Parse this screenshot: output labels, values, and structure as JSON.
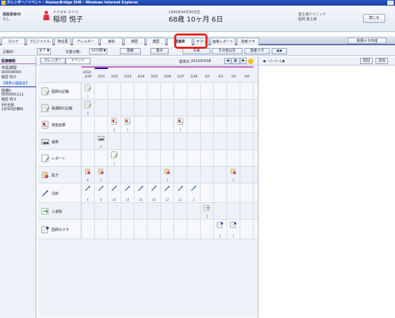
{
  "window": {
    "title": "カレンダー／イベント - HumanBridge EHR - Windows Internet Explorer"
  },
  "patient": {
    "facility_label": "施設患者ID",
    "facility_value": "なし",
    "kana": "イナガキ エツコ",
    "name": "稲垣 悦子",
    "birth": "1945年04月30日生",
    "age": "68歳 10ヶ月 6日",
    "clinic": "富士通クリニック",
    "doctor": "医師 富士通",
    "close_label": "閉じる"
  },
  "tabs": [
    "カルテ",
    "プロファイル",
    "既往歴",
    "アレルギー",
    "病名",
    "検歴",
    "薬歴",
    "経過表",
    "サマリ",
    "画像レポート",
    "患者メモ"
  ],
  "active_tab": "経過表",
  "new_memo_label": "新規メモ作成",
  "filters": {
    "record_label": "記載科：",
    "record_value": "全て",
    "doc_label": "文書分類：",
    "doc_value": "10分類",
    "search_label": "検索",
    "display_label": "表示",
    "calendar_btn": "外来",
    "other_btn": "その他以外",
    "memo_btn": "患者メモ",
    "nav": "◀ ▶"
  },
  "left_panel": {
    "section": "医療機関",
    "hospital1": "市民病院",
    "id1": "000000000",
    "name1": "稲垣 悦子",
    "note": "【発表公開設定】",
    "hospital2": "医療C",
    "id2": "0000001111",
    "name2": "稲垣 悦子",
    "note2": "9月全般",
    "note3": "1年9月診療科"
  },
  "calendar": {
    "tab1": "カレンダー",
    "tab2": "イベント",
    "base_date_label": "基準日：",
    "base_date": "2014/03/08",
    "year": "2014",
    "dates": [
      "2/20",
      "2/21",
      "2/22",
      "2/23",
      "2/24",
      "2/25",
      "2/26",
      "2/27",
      "2/28",
      "3/2",
      "3/3",
      "3/5",
      "3/6"
    ]
  },
  "right_panel": {
    "toolbar": "◀  ---/---/---|  ▶",
    "btn1": "前回",
    "btn2": "追加"
  },
  "rows": [
    {
      "label": "医師の記載",
      "icon": "doctor-note-icon",
      "cells": {
        "0": "1"
      }
    },
    {
      "label": "看護師の記載",
      "icon": "nurse-note-icon",
      "cells": {
        "0": "4"
      }
    },
    {
      "label": "検査結果",
      "icon": "lab-result-icon",
      "cells": {
        "2": "2",
        "3": "1",
        "7": "1"
      }
    },
    {
      "label": "画像",
      "icon": "image-icon",
      "cells": {
        "1": "2"
      }
    },
    {
      "label": "レポート",
      "icon": "report-icon",
      "cells": {
        "2": "1"
      }
    },
    {
      "label": "処方",
      "icon": "prescription-icon",
      "cells": {
        "0": "6",
        "1": "1",
        "6": "1",
        "11": "1"
      }
    },
    {
      "label": "注射",
      "icon": "injection-icon",
      "cells": {
        "0": "6",
        "1": "6",
        "2": "14",
        "3": "14",
        "4": "14",
        "5": "14",
        "6": "12",
        "7": "12",
        "8": "2"
      }
    },
    {
      "label": "入退院",
      "icon": "admission-icon",
      "cells": {
        "9": "1"
      }
    },
    {
      "label": "医師のメモ",
      "icon": "doctor-memo-icon",
      "cells": {
        "10": "3",
        "11": "1"
      }
    }
  ],
  "colors": {
    "accent": "#e8231f",
    "purple": "#c060c0",
    "navy": "#2020a0"
  }
}
